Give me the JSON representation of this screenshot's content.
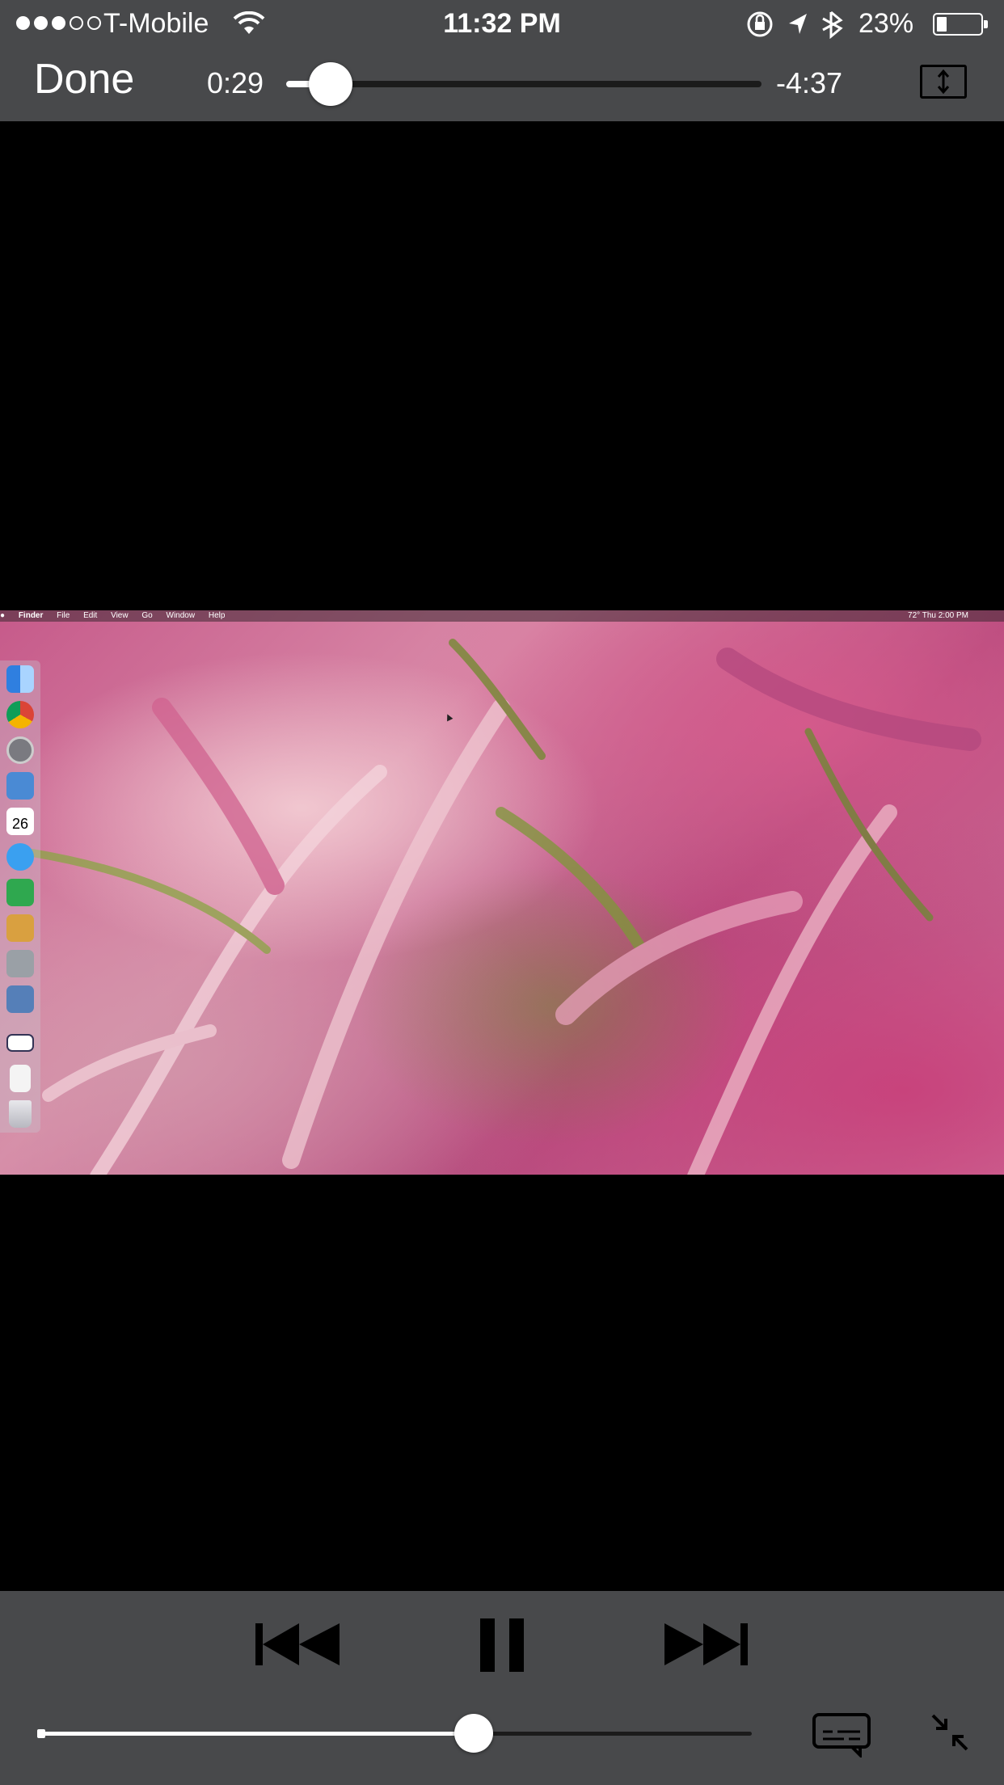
{
  "status_bar": {
    "carrier": "T-Mobile",
    "signal_bars_filled": 3,
    "signal_bars_total": 5,
    "time": "11:32 PM",
    "battery_percent_label": "23%",
    "battery_level": 0.23,
    "icons": [
      "wifi-icon",
      "rotation-lock-icon",
      "location-arrow-icon",
      "bluetooth-icon",
      "battery-icon"
    ]
  },
  "player": {
    "done_label": "Done",
    "elapsed": "0:29",
    "remaining": "-4:37",
    "progress_fraction": 0.094,
    "volume_fraction": 0.61,
    "controls": [
      "skip-back-icon",
      "pause-icon",
      "skip-forward-icon",
      "subtitles-icon",
      "exit-fullscreen-icon",
      "aspect-toggle-icon"
    ]
  },
  "video_frame": {
    "mac_menu_left": [
      "Finder",
      "File",
      "Edit",
      "View",
      "Go",
      "Window",
      "Help"
    ],
    "mac_menu_right": "72°   Thu 2:00 PM",
    "calendar_badge": "26",
    "accent_color": "#c65a8a"
  },
  "colors": {
    "bar_background": "#48494b",
    "track_dark": "#1b1b1b",
    "foreground": "#ffffff"
  }
}
